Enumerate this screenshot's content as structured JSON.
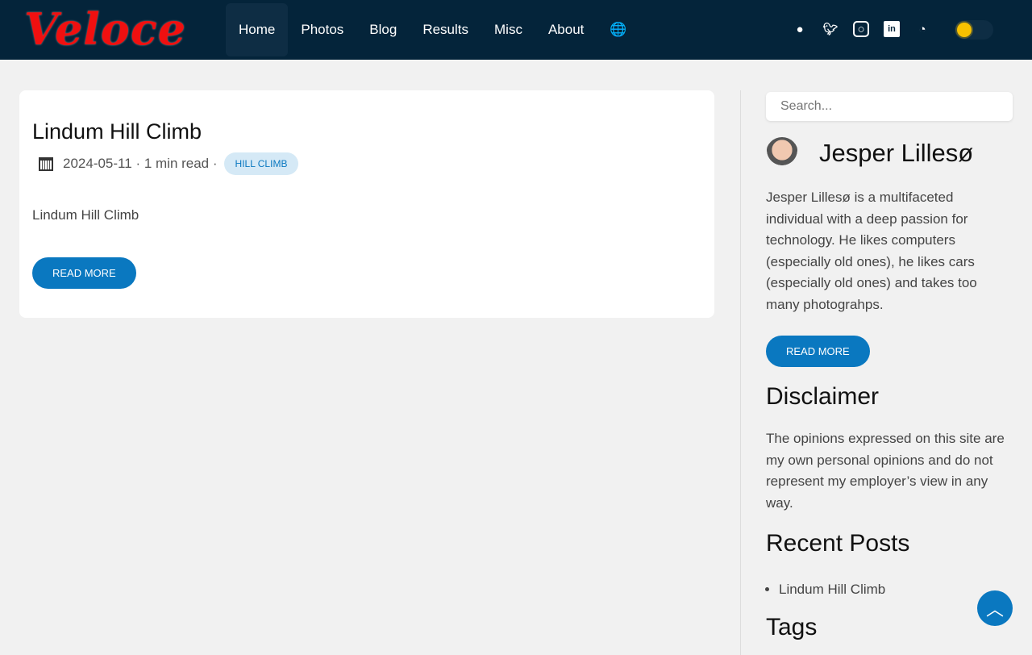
{
  "logo": "Veloce",
  "nav": {
    "items": [
      "Home",
      "Photos",
      "Blog",
      "Results",
      "Misc",
      "About"
    ],
    "lang_icon": "🌐"
  },
  "post": {
    "title": "Lindum Hill Climb",
    "date": "2024-05-11",
    "read": "· 1 min read ·",
    "tag": "HILL CLIMB",
    "summary": "Lindum Hill Climb",
    "read_more": "READ MORE"
  },
  "sidebar": {
    "search_placeholder": "Search...",
    "author": "Jesper Lillesø",
    "bio": "Jesper Lillesø is a multifaceted individual with a deep passion for technology. He likes computers (especially old ones), he likes cars (especially old ones) and takes too many photograhps.",
    "read_more": "READ MORE",
    "disclaimer_title": "Disclaimer",
    "disclaimer": "The opinions expressed on this site are my own personal opinions and do not represent my employer’s view in any way.",
    "recent_title": "Recent Posts",
    "recent": [
      "Lindum Hill Climb"
    ],
    "tags_title": "Tags"
  }
}
